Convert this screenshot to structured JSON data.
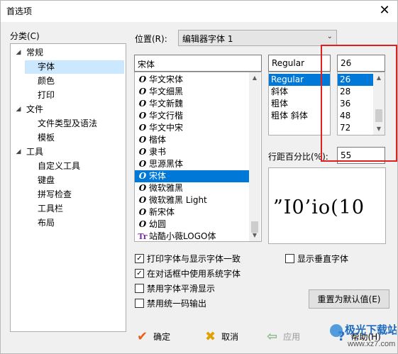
{
  "window": {
    "title": "首选项",
    "close_glyph": "✕"
  },
  "sidebar": {
    "label": "分类(C)",
    "items": [
      {
        "label": "常规",
        "expander": "◢"
      },
      {
        "label": "字体"
      },
      {
        "label": "颜色"
      },
      {
        "label": "打印"
      },
      {
        "label": "文件",
        "expander": "◢"
      },
      {
        "label": "文件类型及语法"
      },
      {
        "label": "模板"
      },
      {
        "label": "工具",
        "expander": "◢"
      },
      {
        "label": "自定义工具"
      },
      {
        "label": "键盘"
      },
      {
        "label": "拼写检查"
      },
      {
        "label": "工具栏"
      },
      {
        "label": "布局"
      }
    ],
    "selected": "字体"
  },
  "location": {
    "label": "位置(R):",
    "value": "编辑器字体 1",
    "arrow": "⌄"
  },
  "font": {
    "value": "宋体",
    "items": [
      {
        "icon": "O",
        "name": "华文宋体"
      },
      {
        "icon": "O",
        "name": "华文细黑"
      },
      {
        "icon": "O",
        "name": "华文新魏"
      },
      {
        "icon": "O",
        "name": "华文行楷"
      },
      {
        "icon": "O",
        "name": "华文中宋"
      },
      {
        "icon": "O",
        "name": "楷体"
      },
      {
        "icon": "O",
        "name": "隶书"
      },
      {
        "icon": "O",
        "name": "思源黑体"
      },
      {
        "icon": "O",
        "name": "宋体",
        "selected": true
      },
      {
        "icon": "O",
        "name": "微软雅黑"
      },
      {
        "icon": "O",
        "name": "微软雅黑 Light"
      },
      {
        "icon": "O",
        "name": "新宋体"
      },
      {
        "icon": "O",
        "name": "幼圆"
      },
      {
        "icon": "Tr",
        "name": "站酷小薇LOGO体"
      }
    ]
  },
  "style": {
    "value": "Regular",
    "items": [
      {
        "name": "Regular",
        "selected": true
      },
      {
        "name": "斜体"
      },
      {
        "name": "粗体"
      },
      {
        "name": "粗体 斜体"
      }
    ]
  },
  "size": {
    "value": "26",
    "items": [
      {
        "name": "26",
        "selected": true
      },
      {
        "name": "28"
      },
      {
        "name": "36"
      },
      {
        "name": "48"
      },
      {
        "name": "72"
      }
    ]
  },
  "scroll_glyphs": {
    "up": "▲",
    "down": "▼"
  },
  "line_spacing": {
    "label": "行距百分比(%):",
    "value": "55"
  },
  "preview": {
    "text": "”I0’io(10"
  },
  "options": {
    "print_same": {
      "label": "打印字体与显示字体一致",
      "checked": true
    },
    "system_font": {
      "label": "在对话框中使用系统字体",
      "checked": true
    },
    "no_smoothing": {
      "label": "禁用字体平滑显示",
      "checked": false
    },
    "no_unicode": {
      "label": "禁用统一码输出",
      "checked": false
    },
    "vertical_font": {
      "label": "显示垂直字体",
      "checked": false
    },
    "check_glyph": "✓"
  },
  "reset_button": "重置为默认值(E)",
  "buttons": {
    "ok": {
      "label": "确定",
      "icon": "✔"
    },
    "cancel": {
      "label": "取消",
      "icon": "✖"
    },
    "apply": {
      "label": "应用",
      "icon": "⇦"
    },
    "help": {
      "label": "帮助(H)",
      "icon": "?"
    }
  },
  "watermark": {
    "brand": "极光下载站",
    "url": "www.xz7.com"
  },
  "colors": {
    "selection": "#0078d7",
    "tree_selection": "#cce8ff",
    "highlight_border": "#e02020"
  }
}
